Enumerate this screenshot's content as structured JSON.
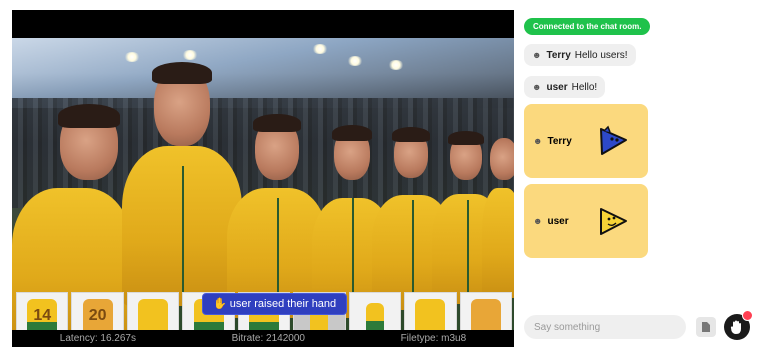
{
  "video": {
    "toast_text": "user raised their hand",
    "kit_numbers": [
      "14",
      "20"
    ],
    "stats": {
      "latency": "Latency: 16.267s",
      "bitrate": "Bitrate: 2142000",
      "filetype": "Filetype: m3u8"
    }
  },
  "chat": {
    "status": "Connected to the chat room.",
    "messages": [
      {
        "user": "Terry",
        "text": "Hello users!",
        "avatar": "avatar-icon"
      },
      {
        "user": "user",
        "text": "Hello!",
        "avatar": "avatar-icon"
      }
    ],
    "stickers": [
      {
        "user": "Terry",
        "sticker": "blue-play-sticker",
        "color": "#2d49c9"
      },
      {
        "user": "user",
        "sticker": "yellow-play-sticker",
        "color": "#f7d437"
      }
    ],
    "input_placeholder": "Say something"
  },
  "colors": {
    "connected_badge": "#1fc24b",
    "sticker_bubble": "#fbd97e",
    "toast": "#2f3fbf",
    "notification_dot": "#ff4053"
  }
}
